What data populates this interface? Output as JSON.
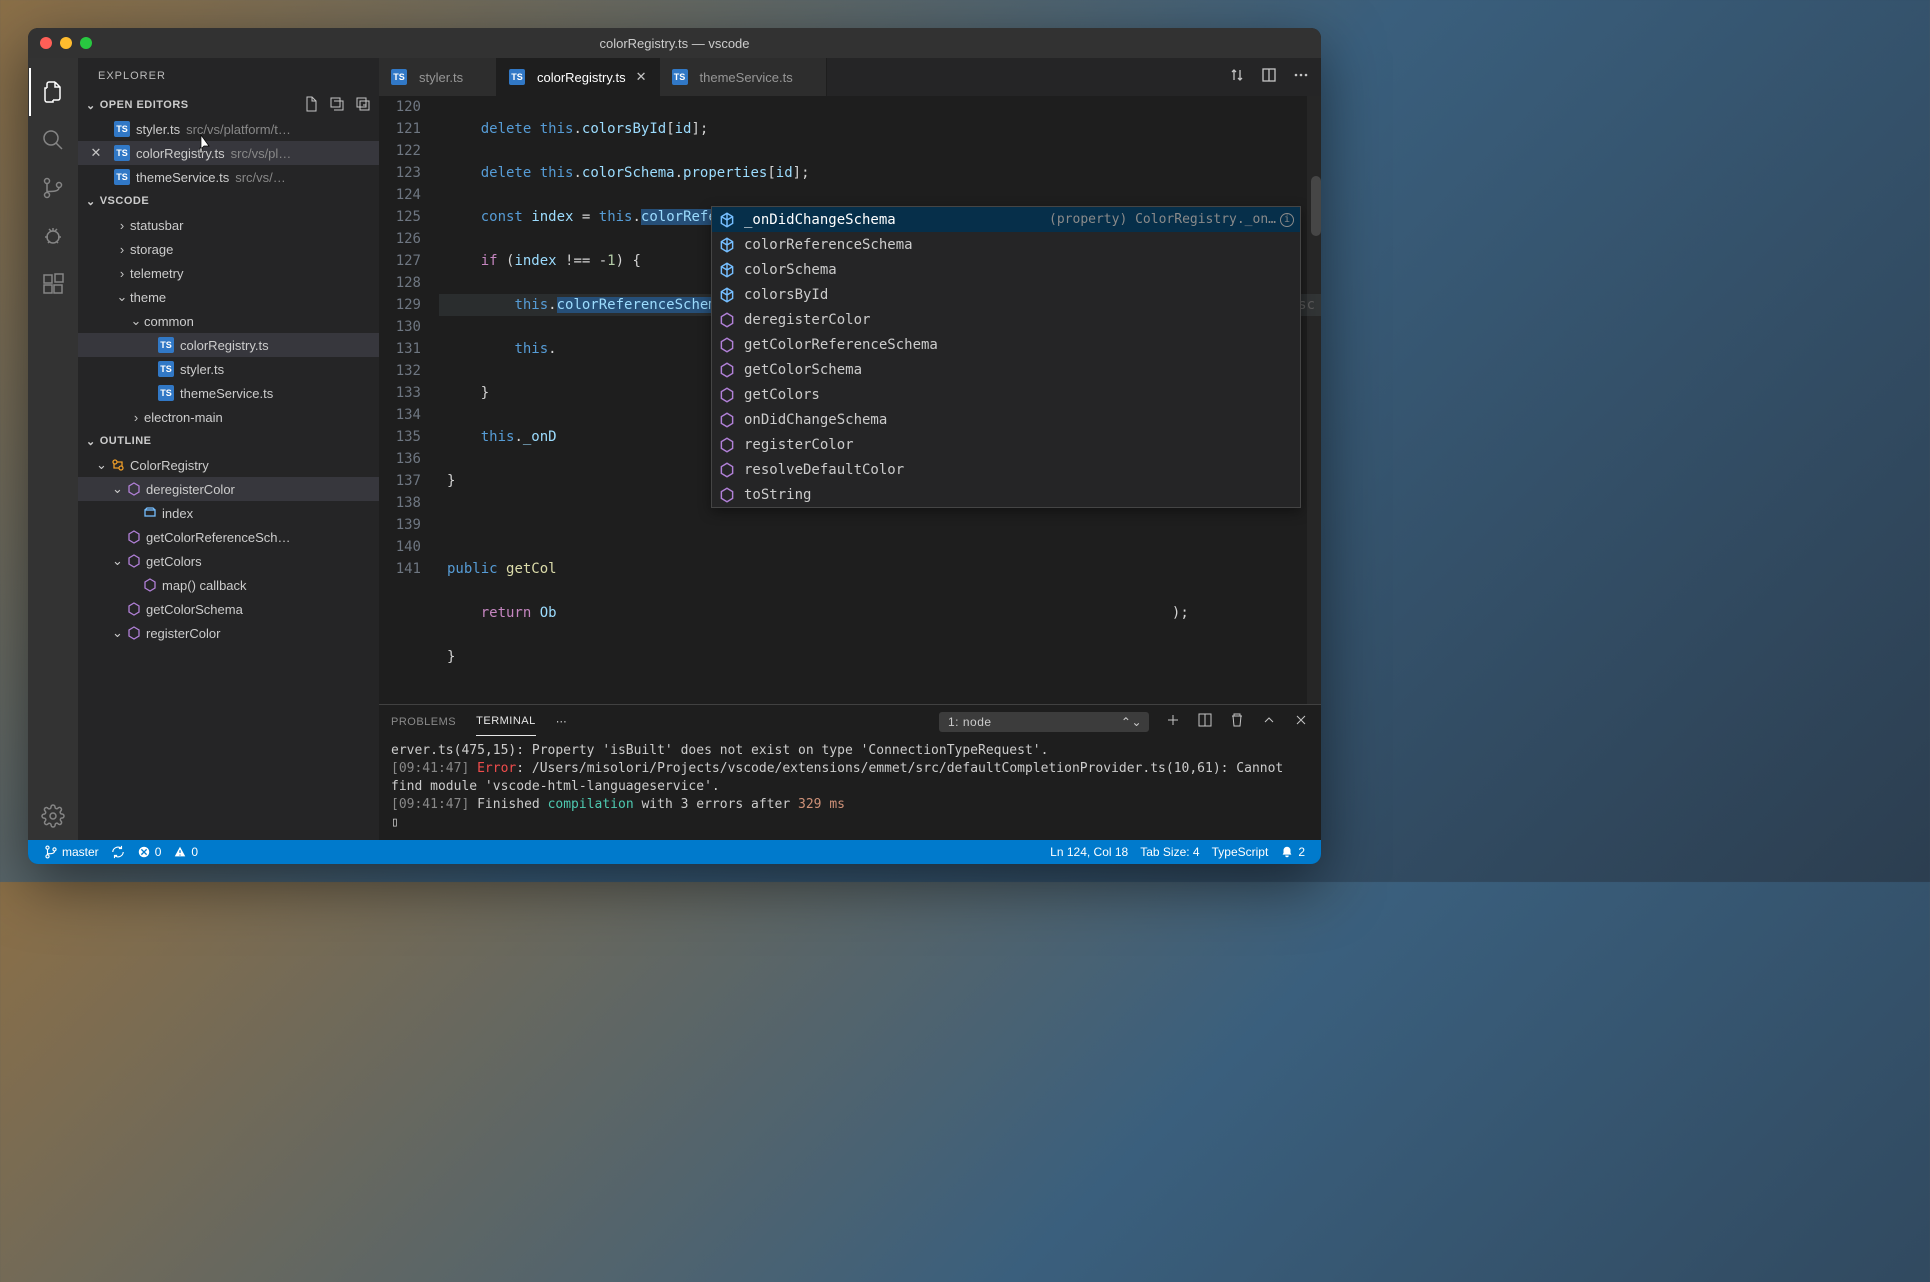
{
  "window": {
    "title": "colorRegistry.ts — vscode"
  },
  "activity": {
    "active": "explorer"
  },
  "sidebar": {
    "header": "EXPLORER",
    "openEditors": {
      "title": "OPEN EDITORS",
      "items": [
        {
          "name": "styler.ts",
          "desc": "src/vs/platform/t…",
          "active": false
        },
        {
          "name": "colorRegistry.ts",
          "desc": "src/vs/pl…",
          "active": true
        },
        {
          "name": "themeService.ts",
          "desc": "src/vs/…",
          "active": false
        }
      ]
    },
    "workspace": {
      "title": "VSCODE",
      "tree": [
        {
          "indent": 2,
          "chev": "›",
          "label": "statusbar"
        },
        {
          "indent": 2,
          "chev": "›",
          "label": "storage"
        },
        {
          "indent": 2,
          "chev": "›",
          "label": "telemetry"
        },
        {
          "indent": 2,
          "chev": "⌄",
          "label": "theme"
        },
        {
          "indent": 3,
          "chev": "⌄",
          "label": "common"
        },
        {
          "indent": 4,
          "chev": "",
          "label": "colorRegistry.ts",
          "ts": true,
          "active": true
        },
        {
          "indent": 4,
          "chev": "",
          "label": "styler.ts",
          "ts": true
        },
        {
          "indent": 4,
          "chev": "",
          "label": "themeService.ts",
          "ts": true
        },
        {
          "indent": 3,
          "chev": "›",
          "label": "electron-main"
        }
      ]
    },
    "outline": {
      "title": "OUTLINE",
      "items": [
        {
          "indent": 0,
          "chev": "⌄",
          "icon": "class",
          "label": "ColorRegistry"
        },
        {
          "indent": 1,
          "chev": "⌄",
          "icon": "method",
          "label": "deregisterColor",
          "active": true
        },
        {
          "indent": 2,
          "chev": "",
          "icon": "var",
          "label": "index"
        },
        {
          "indent": 1,
          "chev": "",
          "icon": "method",
          "label": "getColorReferenceSch…"
        },
        {
          "indent": 1,
          "chev": "⌄",
          "icon": "method",
          "label": "getColors"
        },
        {
          "indent": 2,
          "chev": "",
          "icon": "method",
          "label": "map() callback"
        },
        {
          "indent": 1,
          "chev": "",
          "icon": "method",
          "label": "getColorSchema"
        },
        {
          "indent": 1,
          "chev": "⌄",
          "icon": "method",
          "label": "registerColor"
        }
      ]
    }
  },
  "tabs": [
    {
      "name": "styler.ts",
      "active": false
    },
    {
      "name": "colorRegistry.ts",
      "active": true
    },
    {
      "name": "themeService.ts",
      "active": false
    }
  ],
  "gutter": {
    "start": 120,
    "end": 141
  },
  "code_author": "Martin Aesc",
  "suggest": {
    "items": [
      {
        "icon": "prop",
        "label": "_onDidChangeSchema",
        "detail": "(property) ColorRegistry._on…",
        "sel": true,
        "info": true
      },
      {
        "icon": "prop",
        "label": "colorReferenceSchema"
      },
      {
        "icon": "prop",
        "label": "colorSchema"
      },
      {
        "icon": "prop",
        "label": "colorsById"
      },
      {
        "icon": "method",
        "label": "deregisterColor"
      },
      {
        "icon": "method",
        "label": "getColorReferenceSchema"
      },
      {
        "icon": "method",
        "label": "getColorSchema"
      },
      {
        "icon": "method",
        "label": "getColors"
      },
      {
        "icon": "method",
        "label": "onDidChangeSchema"
      },
      {
        "icon": "method",
        "label": "registerColor"
      },
      {
        "icon": "method",
        "label": "resolveDefaultColor"
      },
      {
        "icon": "method",
        "label": "toString"
      }
    ]
  },
  "panel": {
    "tabs": {
      "problems": "PROBLEMS",
      "terminal": "TERMINAL"
    },
    "terminal_select": "1: node",
    "lines": [
      {
        "raw": "erver.ts(475,15): Property 'isBuilt' does not exist on type 'ConnectionTypeRequest'."
      },
      {
        "time": "[09:41:47]",
        "err": "Error",
        "rest": ": /Users/misolori/Projects/vscode/extensions/emmet/src/defaultCompletionProvider.ts(10,61): Cannot find module 'vscode-html-languageservice'."
      },
      {
        "time": "[09:41:47]",
        "rest2a": " Finished ",
        "ok": "compilation",
        "rest2b": " with 3 errors after ",
        "num": "329 ms"
      },
      {
        "cursor": "▯"
      }
    ]
  },
  "status": {
    "branch": "master",
    "errors": "0",
    "warnings": "0",
    "lncol": "Ln 124, Col 18",
    "tabsize": "Tab Size: 4",
    "lang": "TypeScript",
    "notif": "2"
  }
}
